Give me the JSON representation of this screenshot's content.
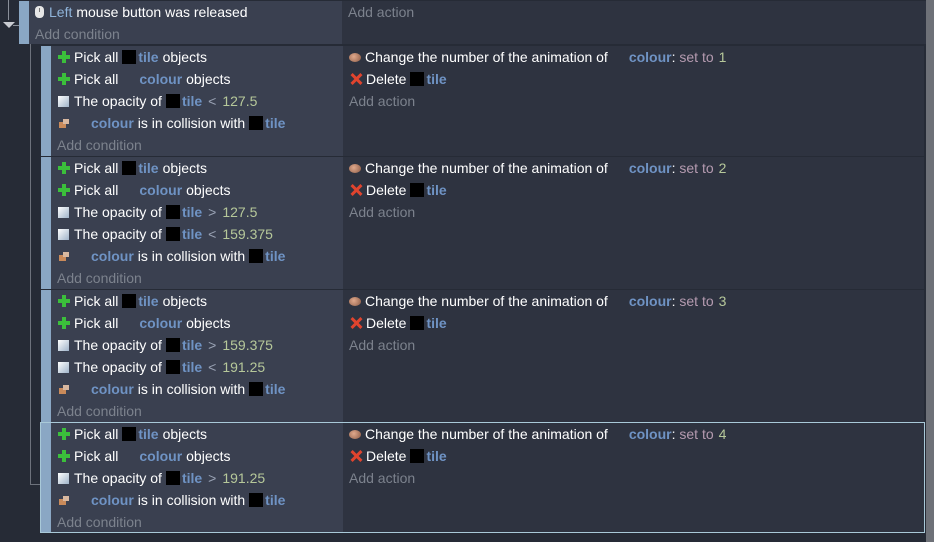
{
  "top_event": {
    "condition": {
      "icon": "mouse-icon",
      "button": "Left",
      "text": "mouse button was released"
    },
    "add_condition": "Add condition",
    "add_action": "Add action"
  },
  "sub_events": [
    {
      "conditions": [
        {
          "type": "pick",
          "prefix": "Pick all",
          "object": "tile",
          "suffix": "objects",
          "has_thumb": true
        },
        {
          "type": "pick",
          "prefix": "Pick all",
          "object": "colour",
          "suffix": "objects",
          "has_thumb": false
        },
        {
          "type": "opacity",
          "prefix": "The opacity of",
          "object": "tile",
          "op": "<",
          "value": "127.5"
        },
        {
          "type": "collision",
          "object": "colour",
          "text": "is in collision with",
          "target": "tile"
        }
      ],
      "actions": [
        {
          "type": "anim",
          "text": "Change the number of the animation of",
          "object": "colour",
          "setto": "set to",
          "value": "1"
        },
        {
          "type": "delete",
          "text": "Delete",
          "object": "tile"
        }
      ],
      "add_condition": "Add condition",
      "add_action": "Add action",
      "selected": false
    },
    {
      "conditions": [
        {
          "type": "pick",
          "prefix": "Pick all",
          "object": "tile",
          "suffix": "objects",
          "has_thumb": true
        },
        {
          "type": "pick",
          "prefix": "Pick all",
          "object": "colour",
          "suffix": "objects",
          "has_thumb": false
        },
        {
          "type": "opacity",
          "prefix": "The opacity of",
          "object": "tile",
          "op": ">",
          "value": "127.5"
        },
        {
          "type": "opacity",
          "prefix": "The opacity of",
          "object": "tile",
          "op": "<",
          "value": "159.375"
        },
        {
          "type": "collision",
          "object": "colour",
          "text": "is in collision with",
          "target": "tile"
        }
      ],
      "actions": [
        {
          "type": "anim",
          "text": "Change the number of the animation of",
          "object": "colour",
          "setto": "set to",
          "value": "2"
        },
        {
          "type": "delete",
          "text": "Delete",
          "object": "tile"
        }
      ],
      "add_condition": "Add condition",
      "add_action": "Add action",
      "selected": false
    },
    {
      "conditions": [
        {
          "type": "pick",
          "prefix": "Pick all",
          "object": "tile",
          "suffix": "objects",
          "has_thumb": true
        },
        {
          "type": "pick",
          "prefix": "Pick all",
          "object": "colour",
          "suffix": "objects",
          "has_thumb": false
        },
        {
          "type": "opacity",
          "prefix": "The opacity of",
          "object": "tile",
          "op": ">",
          "value": "159.375"
        },
        {
          "type": "opacity",
          "prefix": "The opacity of",
          "object": "tile",
          "op": "<",
          "value": "191.25"
        },
        {
          "type": "collision",
          "object": "colour",
          "text": "is in collision with",
          "target": "tile"
        }
      ],
      "actions": [
        {
          "type": "anim",
          "text": "Change the number of the animation of",
          "object": "colour",
          "setto": "set to",
          "value": "3"
        },
        {
          "type": "delete",
          "text": "Delete",
          "object": "tile"
        }
      ],
      "add_condition": "Add condition",
      "add_action": "Add action",
      "selected": false
    },
    {
      "conditions": [
        {
          "type": "pick",
          "prefix": "Pick all",
          "object": "tile",
          "suffix": "objects",
          "has_thumb": true
        },
        {
          "type": "pick",
          "prefix": "Pick all",
          "object": "colour",
          "suffix": "objects",
          "has_thumb": false
        },
        {
          "type": "opacity",
          "prefix": "The opacity of",
          "object": "tile",
          "op": ">",
          "value": "191.25"
        },
        {
          "type": "collision",
          "object": "colour",
          "text": "is in collision with",
          "target": "tile"
        }
      ],
      "actions": [
        {
          "type": "anim",
          "text": "Change the number of the animation of",
          "object": "colour",
          "setto": "set to",
          "value": "4"
        },
        {
          "type": "delete",
          "text": "Delete",
          "object": "tile"
        }
      ],
      "add_condition": "Add condition",
      "add_action": "Add action",
      "selected": true
    }
  ]
}
